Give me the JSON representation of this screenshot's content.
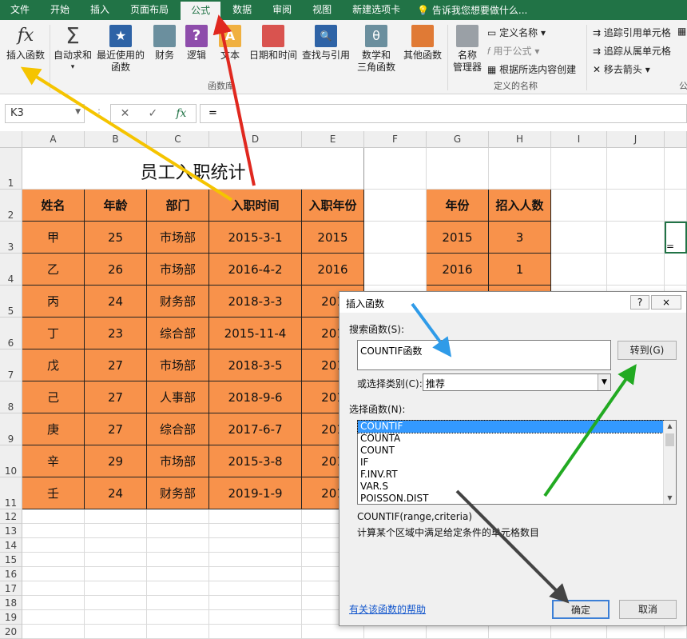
{
  "tabs": [
    "文件",
    "开始",
    "插入",
    "页面布局",
    "公式",
    "数据",
    "审阅",
    "视图",
    "新建选项卡"
  ],
  "active_tab": "公式",
  "tell_me": "告诉我您想要做什么...",
  "ribbon": {
    "insert_function": "插入函数",
    "autosum": [
      "自动求和"
    ],
    "recent": [
      "最近使用的",
      "函数"
    ],
    "financial": "财务",
    "logical": "逻辑",
    "text": "文本",
    "datetime": "日期和时间",
    "lookup": "查找与引用",
    "math": [
      "数学和",
      "三角函数"
    ],
    "other": "其他函数",
    "function_library": "函数库",
    "name_manager": [
      "名称",
      "管理器"
    ],
    "define_name": "定义名称",
    "use_in_formula": "用于公式",
    "create_from_selection": "根据所选内容创建",
    "defined_names": "定义的名称",
    "trace_precedents": "追踪引用单元格",
    "trace_dependents": "追踪从属单元格",
    "remove_arrows": "移去箭头",
    "cut_group": "公"
  },
  "namebox": "K3",
  "formula": "=",
  "columns": [
    "A",
    "B",
    "C",
    "D",
    "E",
    "F",
    "G",
    "H",
    "I",
    "J"
  ],
  "rows": [
    "1",
    "2",
    "3",
    "4",
    "5",
    "6",
    "7",
    "8",
    "9",
    "10",
    "11",
    "12",
    "13",
    "14",
    "15",
    "16",
    "17",
    "18",
    "19",
    "20"
  ],
  "sheet_title": "员工入职统计",
  "table_headers": [
    "姓名",
    "年龄",
    "部门",
    "入职时间",
    "入职年份"
  ],
  "table_rows": [
    [
      "甲",
      "25",
      "市场部",
      "2015-3-1",
      "2015"
    ],
    [
      "乙",
      "26",
      "市场部",
      "2016-4-2",
      "2016"
    ],
    [
      "丙",
      "24",
      "财务部",
      "2018-3-3",
      "201"
    ],
    [
      "丁",
      "23",
      "综合部",
      "2015-11-4",
      "201"
    ],
    [
      "戊",
      "27",
      "市场部",
      "2018-3-5",
      "201"
    ],
    [
      "己",
      "27",
      "人事部",
      "2018-9-6",
      "201"
    ],
    [
      "庚",
      "27",
      "综合部",
      "2017-6-7",
      "201"
    ],
    [
      "辛",
      "29",
      "市场部",
      "2015-3-8",
      "201"
    ],
    [
      "壬",
      "24",
      "财务部",
      "2019-1-9",
      "201"
    ]
  ],
  "summary_headers": [
    "年份",
    "招入人数"
  ],
  "summary_rows": [
    [
      "2015",
      "3"
    ],
    [
      "2016",
      "1"
    ]
  ],
  "active_cell_value": "=",
  "dialog": {
    "title": "插入函数",
    "help": "?",
    "close": "×",
    "search_label": "搜索函数(S):",
    "search_value": "COUNTIF函数",
    "go_button": "转到(G)",
    "category_label": "或选择类别(C):",
    "category_value": "推荐",
    "select_label": "选择函数(N):",
    "functions": [
      "COUNTIF",
      "COUNTA",
      "COUNT",
      "IF",
      "F.INV.RT",
      "VAR.S",
      "POISSON.DIST"
    ],
    "syntax": "COUNTIF(range,criteria)",
    "description": "计算某个区域中满足给定条件的单元格数目",
    "help_link": "有关该函数的帮助",
    "ok": "确定",
    "cancel": "取消"
  },
  "colors": {
    "excel_green": "#217346",
    "orange": "#f8924b",
    "link": "#1155cc",
    "yellow_arrow": "#f5c400",
    "red_arrow": "#e0281f",
    "blue_arrow": "#2f9be8",
    "green_arrow": "#22aa22",
    "black_arrow": "#444444"
  }
}
